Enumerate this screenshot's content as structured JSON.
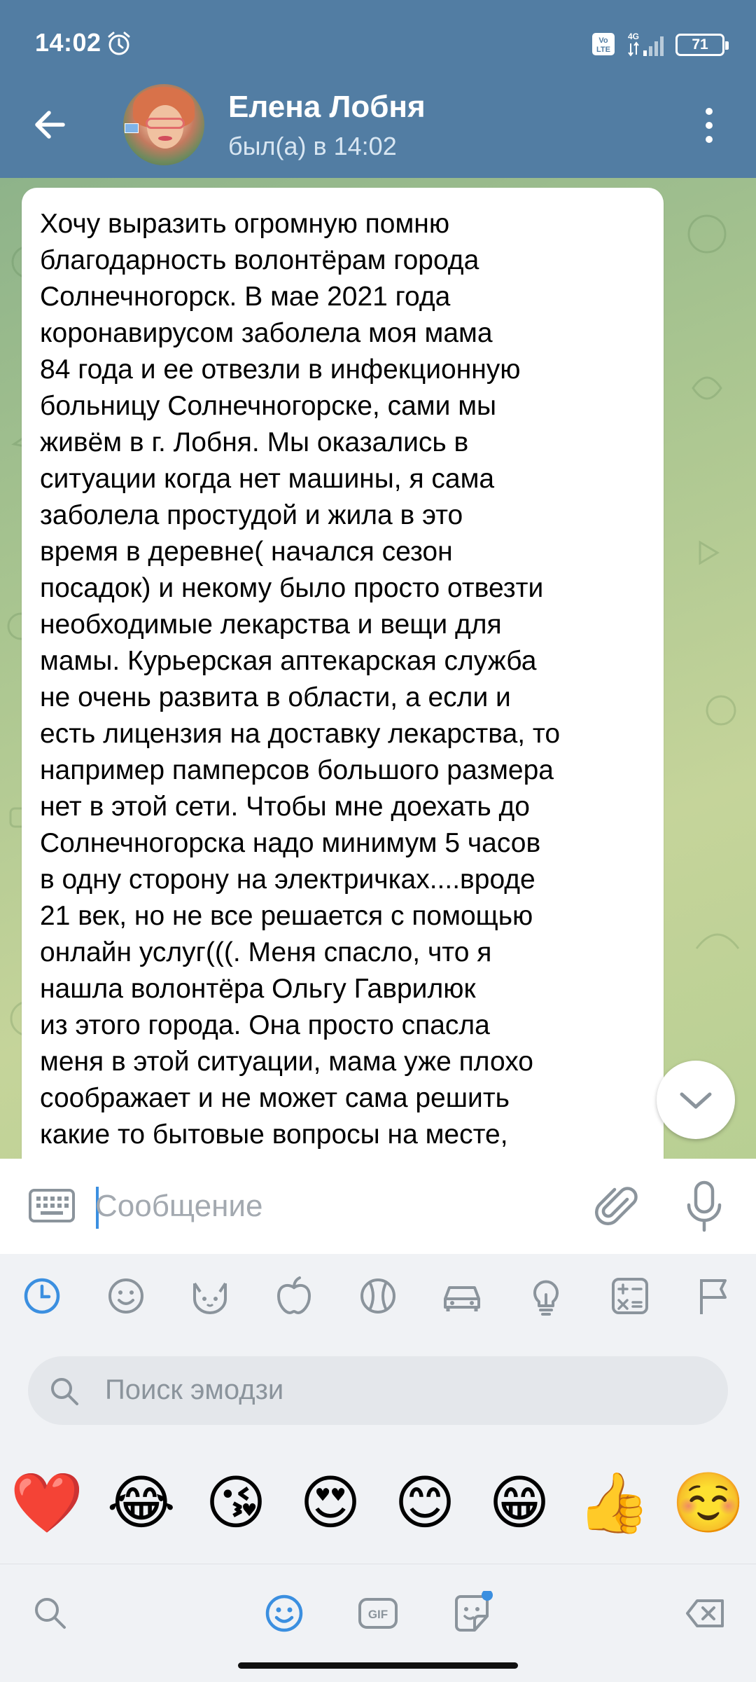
{
  "status_bar": {
    "time": "14:02",
    "battery": "71",
    "network": "4G",
    "volte_label": "Vo LTE"
  },
  "header": {
    "contact_name": "Елена Лобня",
    "contact_status": "был(а) в 14:02"
  },
  "message": {
    "text": "Хочу выразить огромную помню\nблагодарность волонтёрам города\nСолнечногорск. В мае 2021 года\nкоронавирусом заболела моя мама\n84 года и ее отвезли в инфекционную\nбольницу Солнечногорске, сами мы\nживём в г. Лобня. Мы оказались в\nситуации когда нет машины, я сама\nзаболела простудой и жила в это\nвремя в деревне( начался сезон\nпосадок) и некому было просто отвезти\nнеобходимые лекарства и вещи для\nмамы. Курьерская аптекарская служба\nне очень развита в области, а если и\nесть лицензия на доставку лекарства, то\nнапример памперсов большого размера\nнет в этой сети. Чтобы мне доехать до\nСолнечногорска надо минимум 5 часов\nв одну сторону на электричках....вроде\n21 век, но не все решается с помощью\nонлайн услуг(((. Меня спасло, что я\nнашла волонтёра Ольгу Гаврилюк\nиз этого города. Она просто спасла\nменя в этой ситуации, мама уже плохо\nсоображает и не может сама решить\nкакие то бытовые вопросы на месте,"
  },
  "input": {
    "placeholder": "Сообщение",
    "value": ""
  },
  "emoji_panel": {
    "categories": [
      "recent-icon",
      "smiley-icon",
      "cat-icon",
      "apple-icon",
      "ball-icon",
      "car-icon",
      "lightbulb-icon",
      "symbols-icon",
      "flag-icon"
    ],
    "search_placeholder": "Поиск эмодзи",
    "emojis": [
      "❤️",
      "😂",
      "😘",
      "😍",
      "😊",
      "😁",
      "👍",
      "☺️"
    ]
  },
  "bottom_tabs": {
    "gif_label": "GIF",
    "active_tab": "emoji"
  },
  "colors": {
    "header_bg": "#527da3",
    "accent": "#3b8fe0",
    "panel_bg": "#f0f2f5",
    "icon_gray": "#8b949c"
  }
}
